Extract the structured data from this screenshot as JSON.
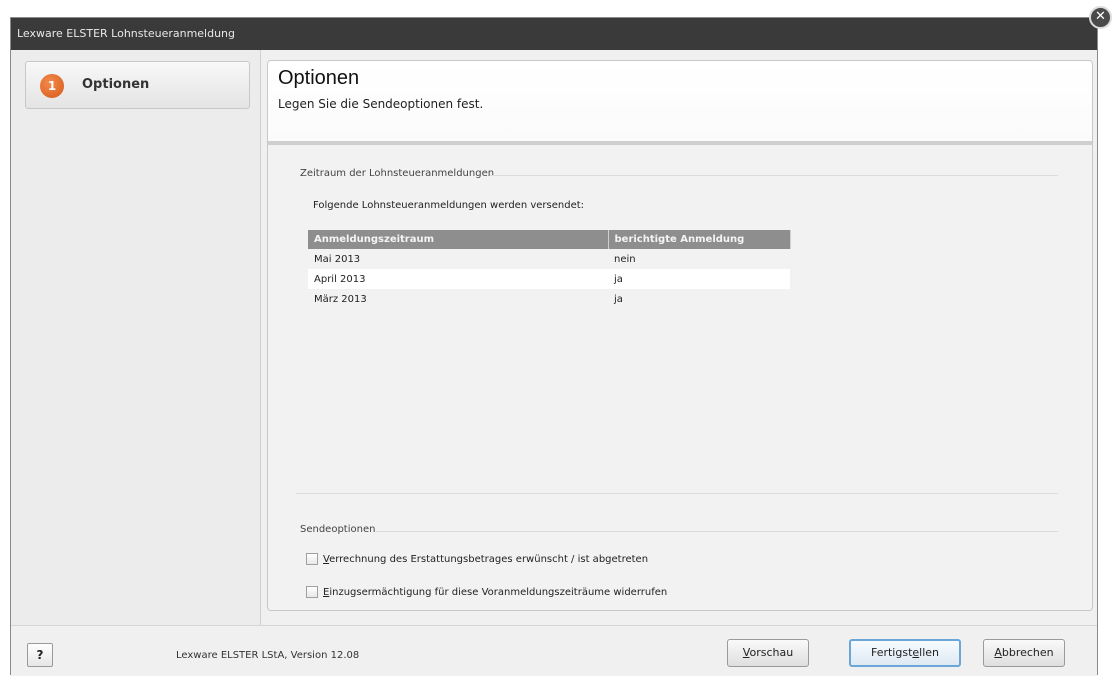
{
  "window": {
    "title": "Lexware ELSTER Lohnsteueranmeldung",
    "close_glyph": "✕"
  },
  "sidebar": {
    "steps": [
      {
        "number": "1",
        "label": "Optionen",
        "active": true
      }
    ]
  },
  "header": {
    "title": "Optionen",
    "subtitle": "Legen Sie die Sendeoptionen fest."
  },
  "period_group": {
    "title": "Zeitraum der Lohnsteueranmeldungen",
    "info": "Folgende Lohnsteueranmeldungen werden versendet:",
    "columns": [
      "Anmeldungszeitraum",
      "berichtigte Anmeldung"
    ],
    "rows": [
      [
        "Mai 2013",
        "nein"
      ],
      [
        "April 2013",
        "ja"
      ],
      [
        "März 2013",
        "ja"
      ]
    ]
  },
  "send_options": {
    "title": "Sendeoptionen",
    "options": [
      {
        "mnemonic": "V",
        "rest": "errechnung des Erstattungsbetrages erwünscht / ist abgetreten",
        "checked": false
      },
      {
        "mnemonic": "E",
        "rest": "inzugsermächtigung für diese Voranmeldungszeiträume widerrufen",
        "checked": false
      }
    ]
  },
  "footer": {
    "help_icon": "?",
    "version": "Lexware ELSTER LStA, Version 12.08",
    "preview": {
      "mnemonic": "V",
      "rest": "orschau"
    },
    "finish": {
      "before": "Fertigst",
      "mnemonic": "e",
      "after": "llen"
    },
    "cancel": {
      "mnemonic": "A",
      "rest": "bbrechen"
    }
  },
  "colors": {
    "titlebar": "#3a3a3a",
    "step_badge": "#e06a28",
    "table_header": "#8e8e8e",
    "primary_button_border": "#6aa7d8"
  }
}
